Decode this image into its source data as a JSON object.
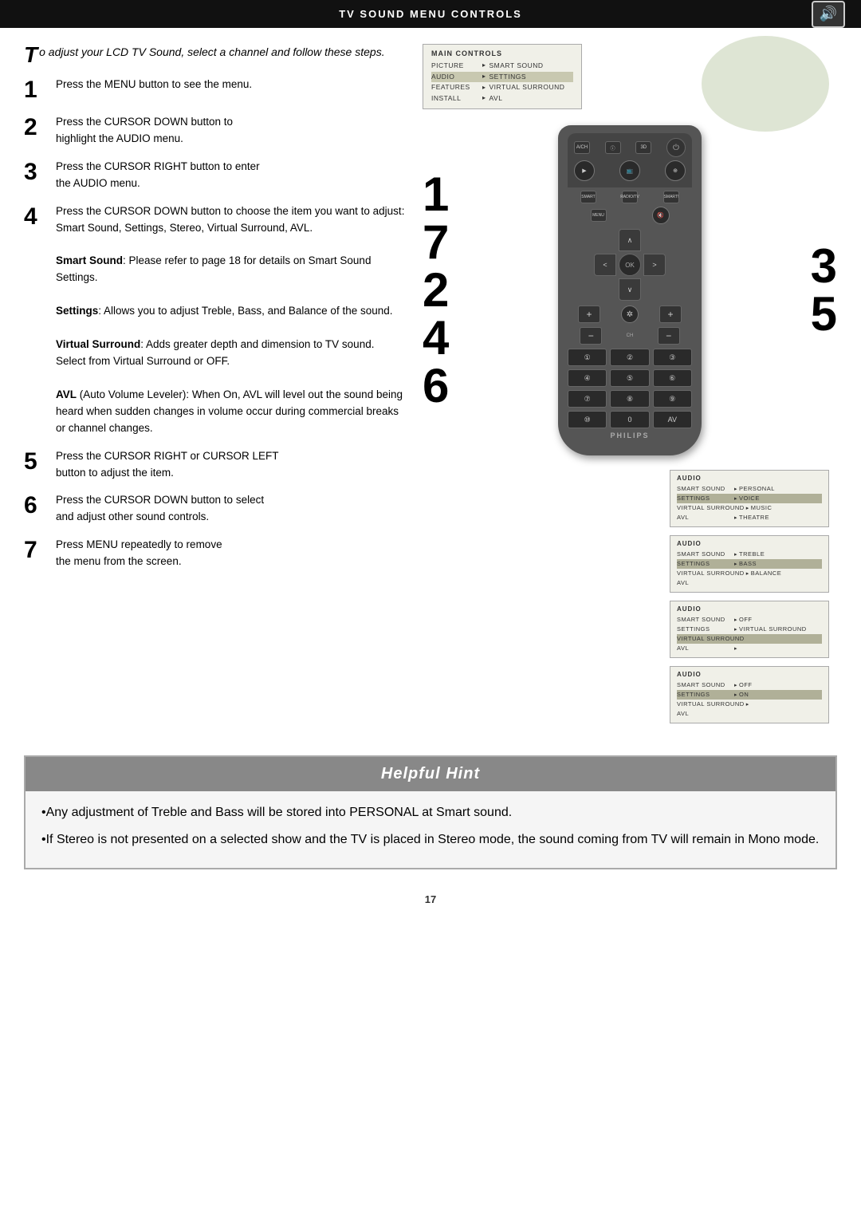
{
  "header": {
    "title": "TV Sound Menu Controls",
    "icon": "🔊"
  },
  "intro": {
    "drop_cap": "T",
    "text": "o adjust your LCD TV Sound, select a channel and follow these steps."
  },
  "steps": [
    {
      "number": "1",
      "text": "Press the MENU button to see the menu."
    },
    {
      "number": "2",
      "text": "Press the CURSOR DOWN button to highlight the AUDIO menu."
    },
    {
      "number": "3",
      "text": "Press the CURSOR RIGHT button to enter the AUDIO menu."
    },
    {
      "number": "4",
      "text": "Press the CURSOR DOWN button to choose the item you want to adjust: Smart Sound, Settings, Stereo, Virtual Surround, AVL.",
      "notes": [
        {
          "label": "Smart Sound",
          "desc": "Please refer to page 18 for details on Smart Sound Settings."
        },
        {
          "label": "Settings",
          "desc": "Allows you to adjust Treble, Bass, and Balance of the sound."
        },
        {
          "label": "Virtual Surround",
          "desc": "Adds greater depth and dimension to TV sound. Select from Virtual Surround or OFF."
        },
        {
          "label": "AVL",
          "desc": "(Auto Volume Leveler): When On, AVL will level out the sound being heard when sudden changes in volume occur during commercial breaks or channel changes."
        }
      ]
    },
    {
      "number": "5",
      "text": "Press the CURSOR RIGHT or CURSOR LEFT button to adjust the item."
    },
    {
      "number": "6",
      "text": "Press the CURSOR DOWN button to select and adjust other sound controls."
    },
    {
      "number": "7",
      "text": "Press MENU repeatedly to remove the menu from the screen."
    }
  ],
  "main_menu": {
    "title": "Main Controls",
    "rows": [
      {
        "key": "Picture",
        "arrow": "▸",
        "val": "Smart Sound",
        "highlighted": false
      },
      {
        "key": "Audio",
        "arrow": "▸",
        "val": "Settings",
        "highlighted": true
      },
      {
        "key": "Features",
        "arrow": "▸",
        "val": "Virtual Surround",
        "highlighted": false
      },
      {
        "key": "Install",
        "arrow": "▸",
        "val": "AVL",
        "highlighted": false
      }
    ]
  },
  "side_menus": [
    {
      "title": "Audio",
      "rows": [
        {
          "key": "Smart Sound",
          "arrow": "▸",
          "val": "Personal",
          "highlighted": false
        },
        {
          "key": "Settings",
          "arrow": "▸",
          "val": "Voice",
          "highlighted": false
        },
        {
          "key": "Virtual Surround",
          "arrow": "▸",
          "val": "Music",
          "highlighted": true
        },
        {
          "key": "AVL",
          "arrow": "▸",
          "val": "Theatre",
          "highlighted": false
        }
      ]
    },
    {
      "title": "Audio",
      "rows": [
        {
          "key": "Smart Sound",
          "arrow": "▸",
          "val": "Treble",
          "highlighted": false
        },
        {
          "key": "Settings",
          "arrow": "▸",
          "val": "Bass",
          "highlighted": true
        },
        {
          "key": "Virtual Surround",
          "arrow": "▸",
          "val": "Balance",
          "highlighted": false
        },
        {
          "key": "AVL",
          "arrow": "",
          "val": "",
          "highlighted": false
        }
      ]
    },
    {
      "title": "Audio",
      "rows": [
        {
          "key": "Smart Sound",
          "arrow": "▸",
          "val": "Off",
          "highlighted": false
        },
        {
          "key": "Settings",
          "arrow": "▸",
          "val": "Virtual Surround",
          "highlighted": false
        },
        {
          "key": "Virtual Surround",
          "arrow": "",
          "val": "",
          "highlighted": true
        },
        {
          "key": "AVL",
          "arrow": "▸",
          "val": "",
          "highlighted": false
        }
      ]
    },
    {
      "title": "Audio",
      "rows": [
        {
          "key": "Smart Sound",
          "arrow": "▸",
          "val": "Off",
          "highlighted": false
        },
        {
          "key": "Settings",
          "arrow": "▸",
          "val": "On",
          "highlighted": false
        },
        {
          "key": "Virtual Surround",
          "arrow": "▸",
          "val": "",
          "highlighted": false
        },
        {
          "key": "AVL",
          "arrow": "",
          "val": "",
          "highlighted": false
        }
      ]
    }
  ],
  "remote": {
    "brand": "PHILIPS",
    "numbers": [
      "1",
      "2",
      "3",
      "4",
      "5",
      "6",
      "7",
      "8",
      "9",
      "⑩",
      "0",
      "AV"
    ]
  },
  "big_numbers_left": [
    "1",
    "7",
    "2",
    "4",
    "6"
  ],
  "big_numbers_right": [
    "3",
    "5"
  ],
  "helpful_hint": {
    "title": "Helpful Hint",
    "bullets": [
      "Any adjustment of Treble and Bass will be stored into PERSONAL at Smart sound.",
      "If Stereo is not presented on a selected show and the TV is placed in Stereo mode, the sound coming from TV will remain in Mono mode."
    ]
  },
  "page_number": "17"
}
